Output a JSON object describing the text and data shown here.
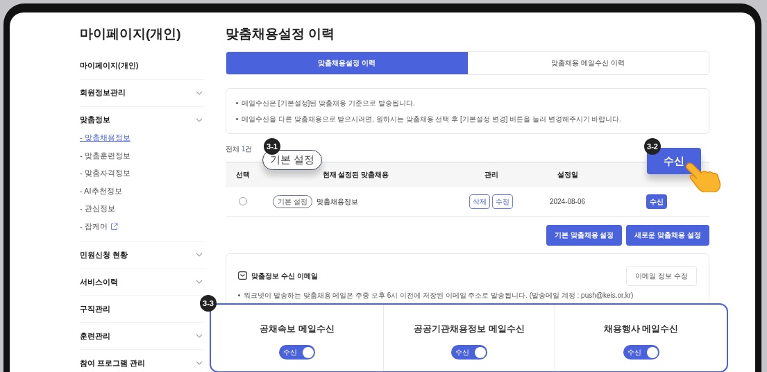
{
  "sidebar": {
    "title": "마이페이지(개인)",
    "items": [
      {
        "label": "마이페이지(개인)",
        "expandable": false
      },
      {
        "label": "회원정보관리",
        "expandable": true
      },
      {
        "label": "맞춤정보",
        "expandable": true,
        "children": [
          {
            "label": "- 맞춤채용정보",
            "selected": true,
            "external": false
          },
          {
            "label": "- 맞춤훈련정보",
            "selected": false,
            "external": false
          },
          {
            "label": "- 맞춤자격정보",
            "selected": false,
            "external": false
          },
          {
            "label": "- AI추천정보",
            "selected": false,
            "external": false
          },
          {
            "label": "- 관심정보",
            "selected": false,
            "external": false
          },
          {
            "label": "- 잡케어",
            "selected": false,
            "external": true
          }
        ]
      },
      {
        "label": "민원신청 현황",
        "expandable": true
      },
      {
        "label": "서비스이력",
        "expandable": true
      },
      {
        "label": "구직관리",
        "expandable": false
      },
      {
        "label": "훈련관리",
        "expandable": true
      },
      {
        "label": "참여 프로그램 관리",
        "expandable": true
      }
    ]
  },
  "main": {
    "title": "맞춤채용설정 이력",
    "tabs": [
      {
        "label": "맞춤채용설정 이력",
        "selected": true
      },
      {
        "label": "맞춤채용 메일수신 이력",
        "selected": false
      }
    ],
    "notices": [
      "메일수신은 [기본설정]된 맞춤채용 기준으로 발송됩니다.",
      "메일수신을 다른 맞춤채용으로 받으시려면, 원하시는 맞춤채용 선택 후 [기본설정 변경] 버튼을 눌러 변경해주시기 바랍니다."
    ],
    "total": {
      "prefix": "전체 ",
      "count": "1",
      "suffix": "건"
    },
    "table": {
      "columns": [
        "선택",
        "현재 설정된 맞춤채용",
        "관리",
        "설정일"
      ],
      "rows": [
        {
          "selected": false,
          "tag": "기본 설정",
          "name": "맞춤채용정보",
          "actions": [
            "삭제",
            "수정"
          ],
          "date": "2024-08-06",
          "receive": "수신"
        }
      ]
    },
    "buttons": [
      "기본 맞춤채용 설정",
      "새로운 맞춤채용 설정"
    ],
    "email": {
      "title": "맞춤정보 수신 이메일",
      "edit_button": "이메일 정보 수정",
      "notice": "워크넷이 발송하는 맞춤채용 메일은 주중 오후 6시 이전에 저장된 이메일 주소로 발송됩니다. (발송메일 계정 : push@keis.or.kr)",
      "subscriptions": [
        {
          "title": "공채속보 메일수신",
          "toggle_label": "수신",
          "on": true
        },
        {
          "title": "공공기관채용정보 메일수신",
          "toggle_label": "수신",
          "on": true
        },
        {
          "title": "채용행사 메일수신",
          "toggle_label": "수신",
          "on": true
        }
      ]
    }
  },
  "callouts": [
    {
      "number": "3-1",
      "text": "기본 설정"
    },
    {
      "number": "3-2",
      "text": "수신"
    },
    {
      "number": "3-3"
    }
  ]
}
